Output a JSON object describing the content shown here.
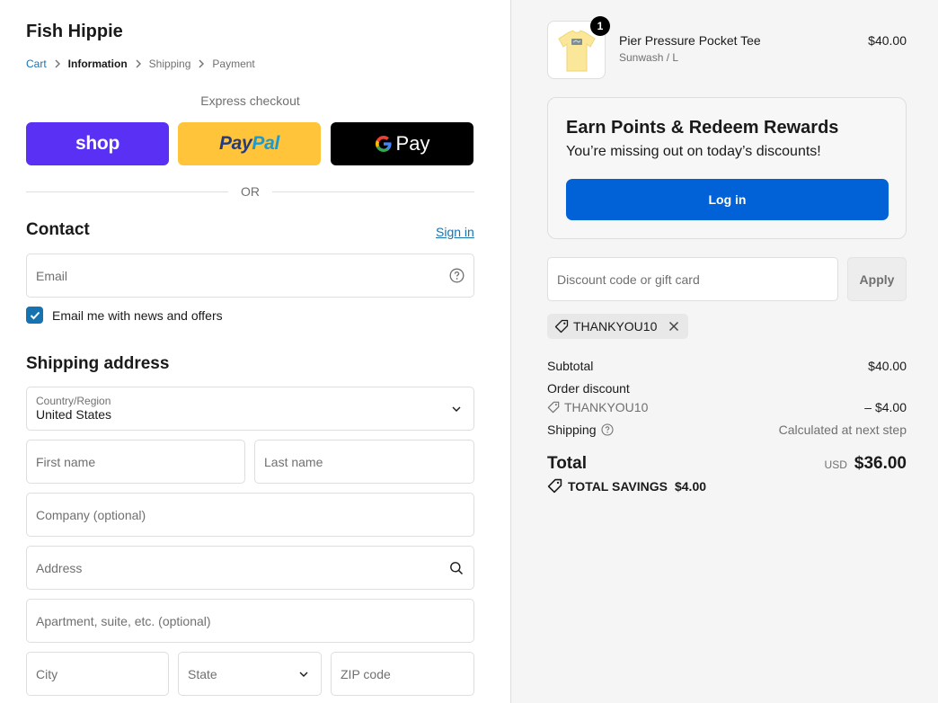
{
  "store": {
    "name": "Fish Hippie"
  },
  "breadcrumb": {
    "items": [
      {
        "label": "Cart"
      },
      {
        "label": "Information"
      },
      {
        "label": "Shipping"
      },
      {
        "label": "Payment"
      }
    ]
  },
  "express": {
    "label": "Express checkout",
    "shop_label": "shop",
    "paypal_part1": "Pay",
    "paypal_part2": "Pal",
    "gpay_label": "Pay",
    "or_label": "OR"
  },
  "contact": {
    "title": "Contact",
    "sign_in": "Sign in",
    "email_placeholder": "Email",
    "news_label": "Email me with news and offers",
    "news_checked": true
  },
  "shipping": {
    "title": "Shipping address",
    "country_label": "Country/Region",
    "country_value": "United States",
    "first_name": "First name",
    "last_name": "Last name",
    "company": "Company (optional)",
    "address": "Address",
    "apartment": "Apartment, suite, etc. (optional)",
    "city": "City",
    "state": "State",
    "zip": "ZIP code"
  },
  "order": {
    "product_name": "Pier Pressure Pocket Tee",
    "product_variant": "Sunwash / L",
    "product_price": "$40.00",
    "quantity": "1"
  },
  "rewards": {
    "title": "Earn Points & Redeem Rewards",
    "subtitle": "You’re missing out on today’s discounts!",
    "login": "Log in"
  },
  "discount": {
    "placeholder": "Discount code or gift card",
    "apply": "Apply",
    "applied_code": "THANKYOU10"
  },
  "summary": {
    "subtotal_label": "Subtotal",
    "subtotal_value": "$40.00",
    "order_discount_label": "Order discount",
    "discount_code": "THANKYOU10",
    "discount_value": "– $4.00",
    "shipping_label": "Shipping",
    "shipping_value": "Calculated at next step",
    "total_label": "Total",
    "currency": "USD",
    "total_value": "$36.00",
    "savings_label": "TOTAL SAVINGS",
    "savings_value": "$4.00"
  },
  "colors": {
    "link": "#1773b0",
    "shop_purple": "#5a31f4",
    "paypal_yellow": "#ffc439",
    "login_blue": "#0062d6"
  }
}
